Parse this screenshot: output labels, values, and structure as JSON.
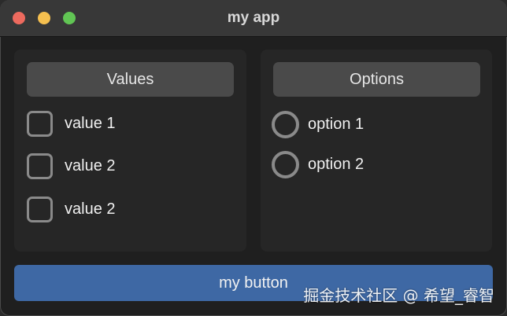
{
  "window": {
    "title": "my app"
  },
  "values_panel": {
    "header": "Values",
    "items": [
      {
        "label": "value 1",
        "checked": false
      },
      {
        "label": "value 2",
        "checked": false
      },
      {
        "label": "value 2",
        "checked": false
      }
    ]
  },
  "options_panel": {
    "header": "Options",
    "items": [
      {
        "label": "option 1",
        "selected": false
      },
      {
        "label": "option 2",
        "selected": false
      }
    ]
  },
  "button": {
    "label": "my button"
  },
  "watermark": "掘金技术社区 @ 希望_睿智",
  "colors": {
    "button": "#3e68a4",
    "close": "#ed6a5e",
    "minimize": "#f5bf4f",
    "zoom": "#61c554"
  }
}
